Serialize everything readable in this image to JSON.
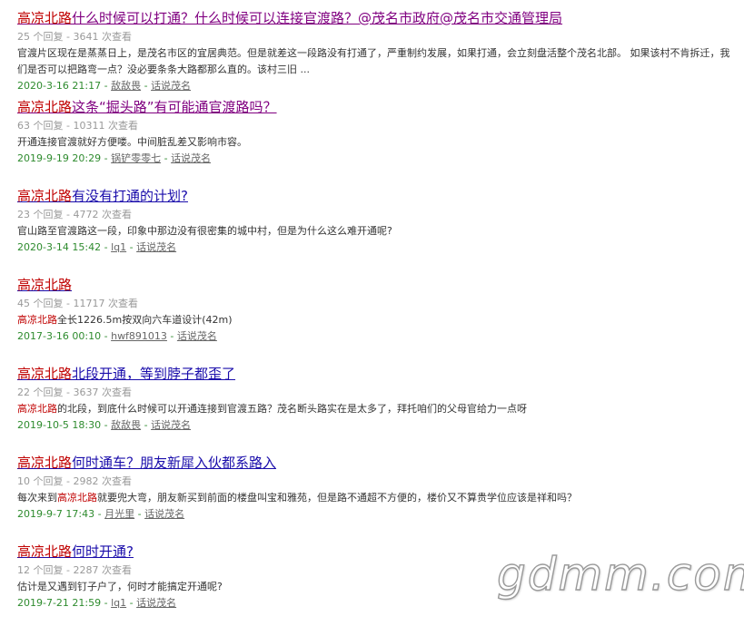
{
  "results": [
    {
      "state": "visited",
      "title_keyword": "高凉北路",
      "title_rest": "什么时候可以打通？什么时候可以连接官渡路？@茂名市政府@茂名市交通管理局",
      "meta": "25 个回复 - 3641 次查看",
      "snippet_pre": "",
      "snippet_keyword": "",
      "snippet_post": "官渡片区现在是蒸蒸日上，是茂名市区的宜居典范。但是就差这一段路没有打通了，严重制约发展，如果打通，会立刻盘活整个茂名北部。 如果该村不肯拆迁，我们是否可以把路弯一点？没必要条条大路都那么直的。该村三旧 ...",
      "date": "2020-3-16 21:17",
      "author": "敌敌畏",
      "forum": "话说茂名"
    },
    {
      "state": "visited",
      "title_keyword": "高凉北路",
      "title_rest": "这条“掘头路”有可能通官渡路吗？",
      "meta": "63 个回复 - 10311 次查看",
      "snippet_pre": "",
      "snippet_keyword": "",
      "snippet_post": "开通连接官渡就好方便喽。中间脏乱差又影响市容。",
      "date": "2019-9-19 20:29",
      "author": "锅铲零零七",
      "forum": "话说茂名"
    },
    {
      "state": "unvisited",
      "title_keyword": "高凉北路",
      "title_rest": "有没有打通的计划?",
      "meta": "23 个回复 - 4772 次查看",
      "snippet_pre": "",
      "snippet_keyword": "",
      "snippet_post": "官山路至官渡路这一段，印象中那边没有很密集的城中村，但是为什么这么难开通呢?",
      "date": "2020-3-14 15:42",
      "author": "lq1",
      "forum": "话说茂名"
    },
    {
      "state": "unvisited",
      "title_keyword": "高凉北路",
      "title_rest": "",
      "meta": "45 个回复 - 11717 次查看",
      "snippet_pre": "",
      "snippet_keyword": "高凉北路",
      "snippet_post": "全长1226.5m按双向六车道设计(42m)",
      "date": "2017-3-16 00:10",
      "author": "hwf891013",
      "forum": "话说茂名"
    },
    {
      "state": "unvisited",
      "title_keyword": "高凉北路",
      "title_rest": "北段开通，等到脖子都歪了",
      "meta": "22 个回复 - 3637 次查看",
      "snippet_pre": "",
      "snippet_keyword": "高凉北路",
      "snippet_post": "的北段，到底什么时候可以开通连接到官渡五路？茂名断头路实在是太多了，拜托咱们的父母官给力一点呀",
      "date": "2019-10-5 18:30",
      "author": "敌敌畏",
      "forum": "话说茂名"
    },
    {
      "state": "unvisited",
      "title_keyword": "高凉北路",
      "title_rest": "何时通车？朋友新犀入伙都系路入",
      "meta": "10 个回复 - 2982 次查看",
      "snippet_pre": "每次来到",
      "snippet_keyword": "高凉北路",
      "snippet_post": "就要兜大弯，朋友新买到前面的楼盘叫宝和雅苑，但是路不通超不方便的，楼价又不算贵学位应该是祥和吗？",
      "date": "2019-9-7 17:43",
      "author": "月光里",
      "forum": "话说茂名"
    },
    {
      "state": "unvisited",
      "title_keyword": "高凉北路",
      "title_rest": "何时开通?",
      "meta": "12 个回复 - 2287 次查看",
      "snippet_pre": "",
      "snippet_keyword": "",
      "snippet_post": "估计是又遇到钉子户了，何时才能搞定开通呢?",
      "date": "2019-7-21 21:59",
      "author": "lq1",
      "forum": "话说茂名"
    }
  ],
  "separator": " - ",
  "watermark": "gdmm.com",
  "colors": {
    "keyword": "#c00000",
    "visited_link": "#800080",
    "unvisited_link": "#1a0dab",
    "meta": "#999999",
    "date": "#2e8b2e"
  }
}
